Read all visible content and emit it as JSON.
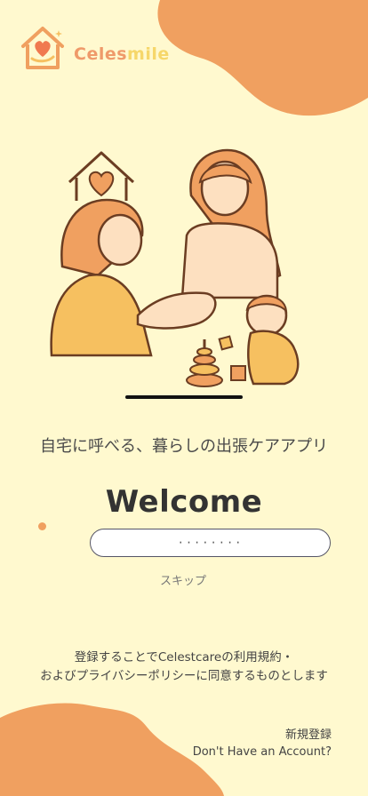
{
  "brand": {
    "name_part1": "Celes",
    "name_part2": "mile"
  },
  "tagline": "自宅に呼べる、暮らしの出張ケアアプリ",
  "welcome": "Welcome",
  "phone_input": {
    "value": "········"
  },
  "skip_label": "スキップ",
  "terms": {
    "line1": "登録することでCelestcareの利用規約・",
    "line2": "およびプライバシーポリシーに同意するものとします"
  },
  "signup": {
    "label_ja": "新規登録",
    "label_en": "Don't Have an Account?"
  },
  "colors": {
    "background": "#fff9cf",
    "accent_orange": "#f0a060",
    "brand_yellow": "#f6d76a"
  }
}
